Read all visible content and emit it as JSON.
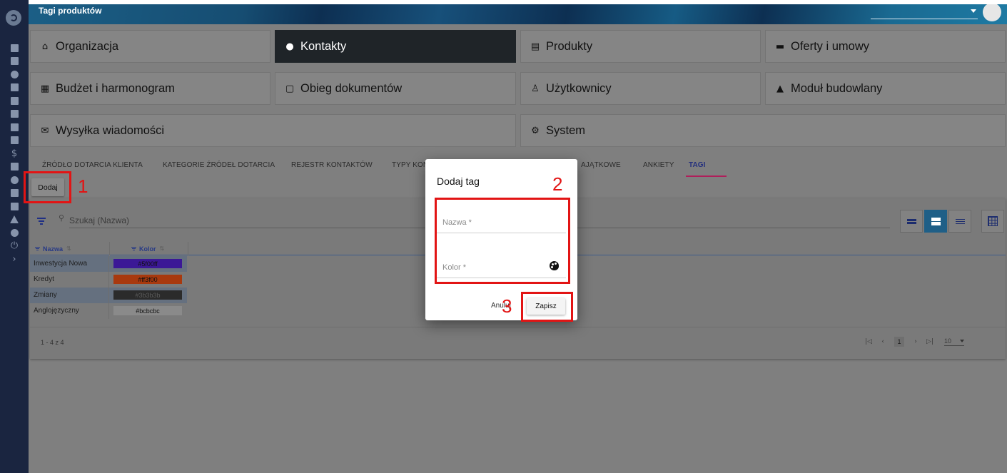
{
  "header": {
    "title": "Tagi produktów"
  },
  "sidebar": {
    "icons": [
      "dashboard-icon",
      "calendar-icon",
      "people-icon",
      "building-icon",
      "store-icon",
      "briefcase-icon",
      "folder-icon",
      "inbox-icon",
      "dollar-icon",
      "document-icon",
      "pie-chart-icon",
      "bar-chart-icon",
      "window-icon",
      "warning-icon",
      "gear-icon",
      "power-icon",
      "chevron-right-icon"
    ],
    "dollar_glyph": "$",
    "power_glyph": "⏻",
    "chevron_glyph": "›"
  },
  "modules": [
    {
      "label": "Organizacja",
      "icon": "home-icon",
      "glyph": "⌂"
    },
    {
      "label": "Kontakty",
      "icon": "person-icon",
      "glyph": "●"
    },
    {
      "label": "Produkty",
      "icon": "store-icon",
      "glyph": "▤"
    },
    {
      "label": "Oferty i umowy",
      "icon": "folder-icon",
      "glyph": "▬"
    },
    {
      "label": "Budżet i harmonogram",
      "icon": "building-icon",
      "glyph": "▦"
    },
    {
      "label": "Obieg dokumentów",
      "icon": "inbox-icon",
      "glyph": "▢"
    },
    {
      "label": "Użytkownicy",
      "icon": "user-outline-icon",
      "glyph": "♙"
    },
    {
      "label": "Moduł budowlany",
      "icon": "warning-icon",
      "glyph": "▲"
    },
    {
      "label": "Wysyłka wiadomości",
      "icon": "mail-icon",
      "glyph": "✉"
    },
    {
      "label": "System",
      "icon": "gear-icon",
      "glyph": "⚙"
    }
  ],
  "tabs": [
    "ŹRÓDŁO DOTARCIA KLIENTA",
    "KATEGORIE ŹRÓDEŁ DOTARCIA",
    "REJESTR KONTAKTÓW",
    "TYPY KON",
    "AJĄTKOWE",
    "ANKIETY",
    "TAGI"
  ],
  "toolbar": {
    "add_label": "Dodaj"
  },
  "search": {
    "placeholder": "Szukaj (Nazwa)",
    "magnifier": "⚲"
  },
  "table": {
    "columns": [
      "Nazwa",
      "Kolor"
    ],
    "sort_glyph": "⇅",
    "rows": [
      {
        "name": "Inwestycja Nowa",
        "color": "#5f00ff"
      },
      {
        "name": "Kredyt",
        "color": "#ff3f00"
      },
      {
        "name": "Zmiany",
        "color": "#3b3b3b"
      },
      {
        "name": "Anglojęzyczny",
        "color": "#bcbcbc"
      }
    ]
  },
  "pagination": {
    "range": "1 - 4 z 4",
    "first": "|◁",
    "prev": "‹",
    "current": "1",
    "next": "›",
    "last": "▷|",
    "page_size": "10"
  },
  "modal": {
    "title": "Dodaj tag",
    "name_placeholder": "Nazwa *",
    "color_placeholder": "Kolor *",
    "cancel_label": "Anuluj",
    "save_label": "Zapisz"
  },
  "callouts": [
    "1",
    "2",
    "3"
  ],
  "colors": {
    "accent": "#1f5f87",
    "tab_active": "#232f7e",
    "tab_underline": "#b01e5a",
    "callout": "#e21414"
  }
}
